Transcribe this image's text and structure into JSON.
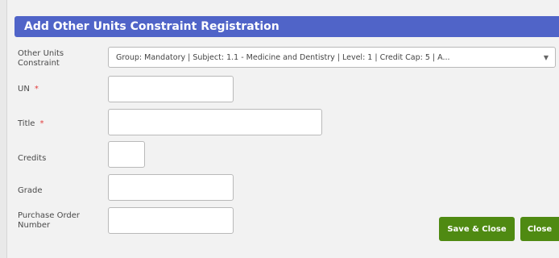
{
  "dialog": {
    "title": "Add Other Units Constraint Registration"
  },
  "form": {
    "other_units_constraint": {
      "label": "Other Units Constraint",
      "value": "Group: Mandatory | Subject: 1.1 - Medicine and Dentistry | Level: 1 | Credit Cap: 5 | A..."
    },
    "un": {
      "label": "UN",
      "required_mark": "*",
      "value": ""
    },
    "title": {
      "label": "Title",
      "required_mark": "*",
      "value": ""
    },
    "credits": {
      "label": "Credits",
      "value": ""
    },
    "grade": {
      "label": "Grade",
      "value": ""
    },
    "purchase_order_number": {
      "label": "Purchase Order Number",
      "value": ""
    }
  },
  "buttons": {
    "save_close": "Save & Close",
    "close": "Close"
  },
  "icons": {
    "dropdown": "chevron-down-icon"
  },
  "colors": {
    "header": "#5064c8",
    "button": "#4f8a12",
    "required": "#e23d3d"
  }
}
